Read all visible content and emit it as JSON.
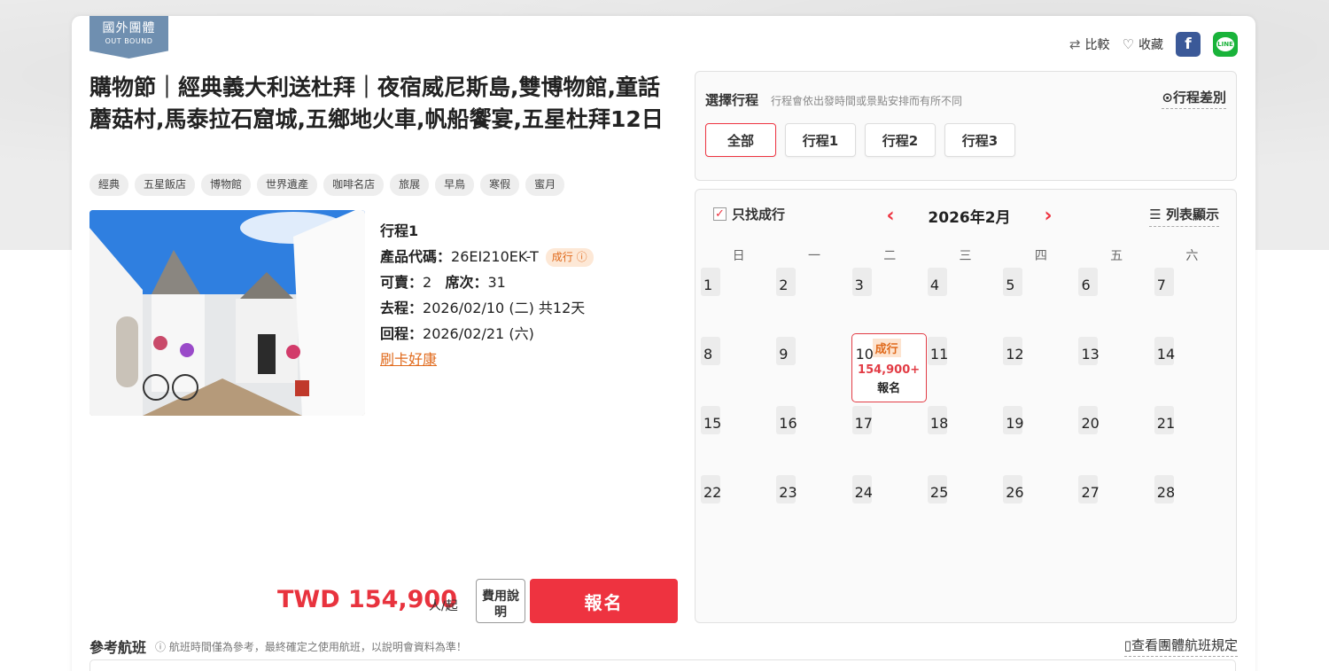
{
  "badge": {
    "zh": "國外團體",
    "en": "OUT BOUND"
  },
  "actions": {
    "compare": "比較",
    "favorite": "收藏",
    "fb": "f",
    "line": "LINE"
  },
  "title": "購物節｜經典義大利送杜拜｜夜宿威尼斯島,雙博物館,童話蘑菇村,馬泰拉石窟城,五鄉地火車,帆船饗宴,五星杜拜12日",
  "tags": [
    "經典",
    "五星飯店",
    "博物館",
    "世界遺產",
    "咖啡名店",
    "旅展",
    "早鳥",
    "寒假",
    "蜜月"
  ],
  "info": {
    "itinerary": "行程1",
    "code_label": "產品代碼：",
    "code": "26EI210EK-T",
    "status": "成行",
    "sellable_label": "可賣：",
    "sellable": "2",
    "seats_label": "席次：",
    "seats": "31",
    "depart_label": "去程：",
    "depart": "2026/02/10 (二)  共12天",
    "return_label": "回程：",
    "return": "2026/02/21 (六)",
    "promo": "刷卡好康"
  },
  "price": {
    "amount": "TWD 154,900",
    "unit": "人/起",
    "fee_button": "費用說明",
    "signup": "報名"
  },
  "selector": {
    "title": "選擇行程",
    "note": "行程會依出發時間或景點安排而有所不同",
    "diff": "行程差別",
    "tabs": [
      "全部",
      "行程1",
      "行程2",
      "行程3"
    ],
    "active_tab": 0
  },
  "calendar": {
    "only_run": "只找成行",
    "month": "2026年2月",
    "list_view": "列表顯示",
    "weekdays": [
      "日",
      "一",
      "二",
      "三",
      "四",
      "五",
      "六"
    ],
    "days": [
      "1",
      "2",
      "3",
      "4",
      "5",
      "6",
      "7",
      "8",
      "9",
      "10",
      "11",
      "12",
      "13",
      "14",
      "15",
      "16",
      "17",
      "18",
      "19",
      "20",
      "21",
      "22",
      "23",
      "24",
      "25",
      "26",
      "27",
      "28"
    ],
    "active": {
      "day": "10",
      "status": "成行",
      "price": "154,900+",
      "signup": "報名"
    }
  },
  "flight": {
    "title": "參考航班",
    "note": "航班時間僅為參考，最終確定之使用航班，以說明會資料為準！",
    "rule": "查看團體航班規定"
  },
  "colors": {
    "accent": "#ee3340",
    "badge": "#6f8fb0",
    "status": "#e06a1c"
  }
}
